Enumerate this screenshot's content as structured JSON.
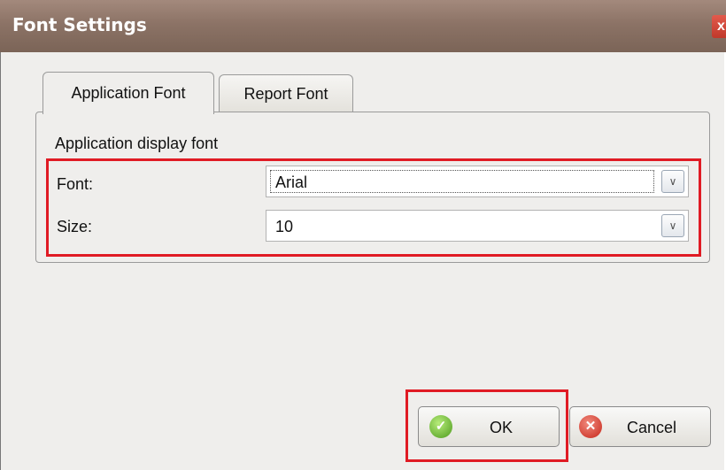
{
  "window": {
    "title": "Font Settings",
    "close_glyph": "x"
  },
  "tabs": [
    {
      "label": "Application Font",
      "active": true
    },
    {
      "label": "Report Font",
      "active": false
    }
  ],
  "group": {
    "label": "Application display font",
    "font_label": "Font:",
    "font_value": "Arial",
    "size_label": "Size:",
    "size_value": "10"
  },
  "buttons": {
    "ok_label": "OK",
    "cancel_label": "Cancel"
  },
  "icons": {
    "ok": "check-circle-icon",
    "cancel": "x-circle-icon",
    "dropdown": "chevron-down-icon",
    "close": "close-icon"
  },
  "colors": {
    "highlight": "#e01b24",
    "titlebar": "#8c7366"
  }
}
